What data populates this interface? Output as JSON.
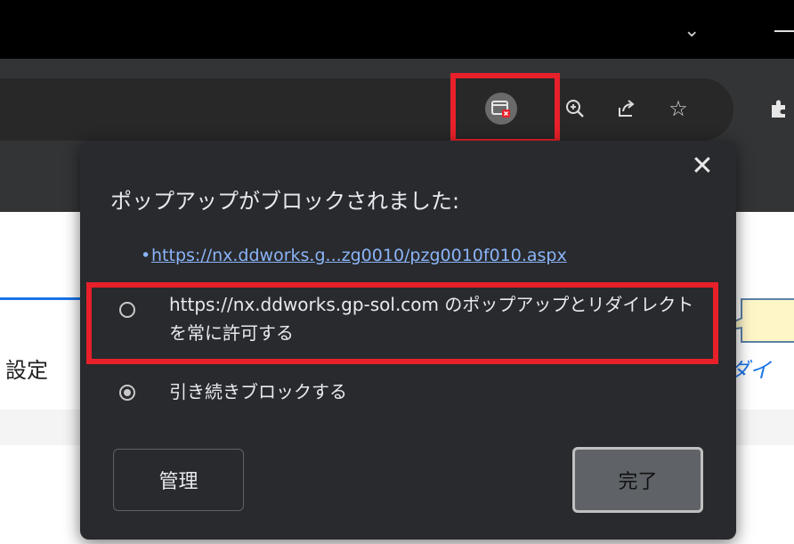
{
  "browser": {
    "icons": [
      "chevron-down-icon",
      "minimize-icon",
      "popup-blocked-icon",
      "zoom-icon",
      "share-icon",
      "star-icon",
      "extensions-icon"
    ]
  },
  "page": {
    "left_label": "設定",
    "right_label": "ダイ"
  },
  "dialog": {
    "title": "ポップアップがブロックされました:",
    "blocked_url": "https://nx.ddworks.g...zg0010/pzg0010f010.aspx",
    "bullet": "•",
    "options": {
      "allow_label": "https://nx.ddworks.gp-sol.com のポップアップとリダイレクトを常に許可する",
      "block_label": "引き続きブロックする",
      "selected": "block"
    },
    "manage_button": "管理",
    "done_button": "完了",
    "close_glyph": "✕"
  },
  "colors": {
    "annotation_red": "#e8202a",
    "link_blue": "#8ab4f8",
    "dialog_bg": "#292a2d",
    "callout_fill": "#fff6c8"
  }
}
